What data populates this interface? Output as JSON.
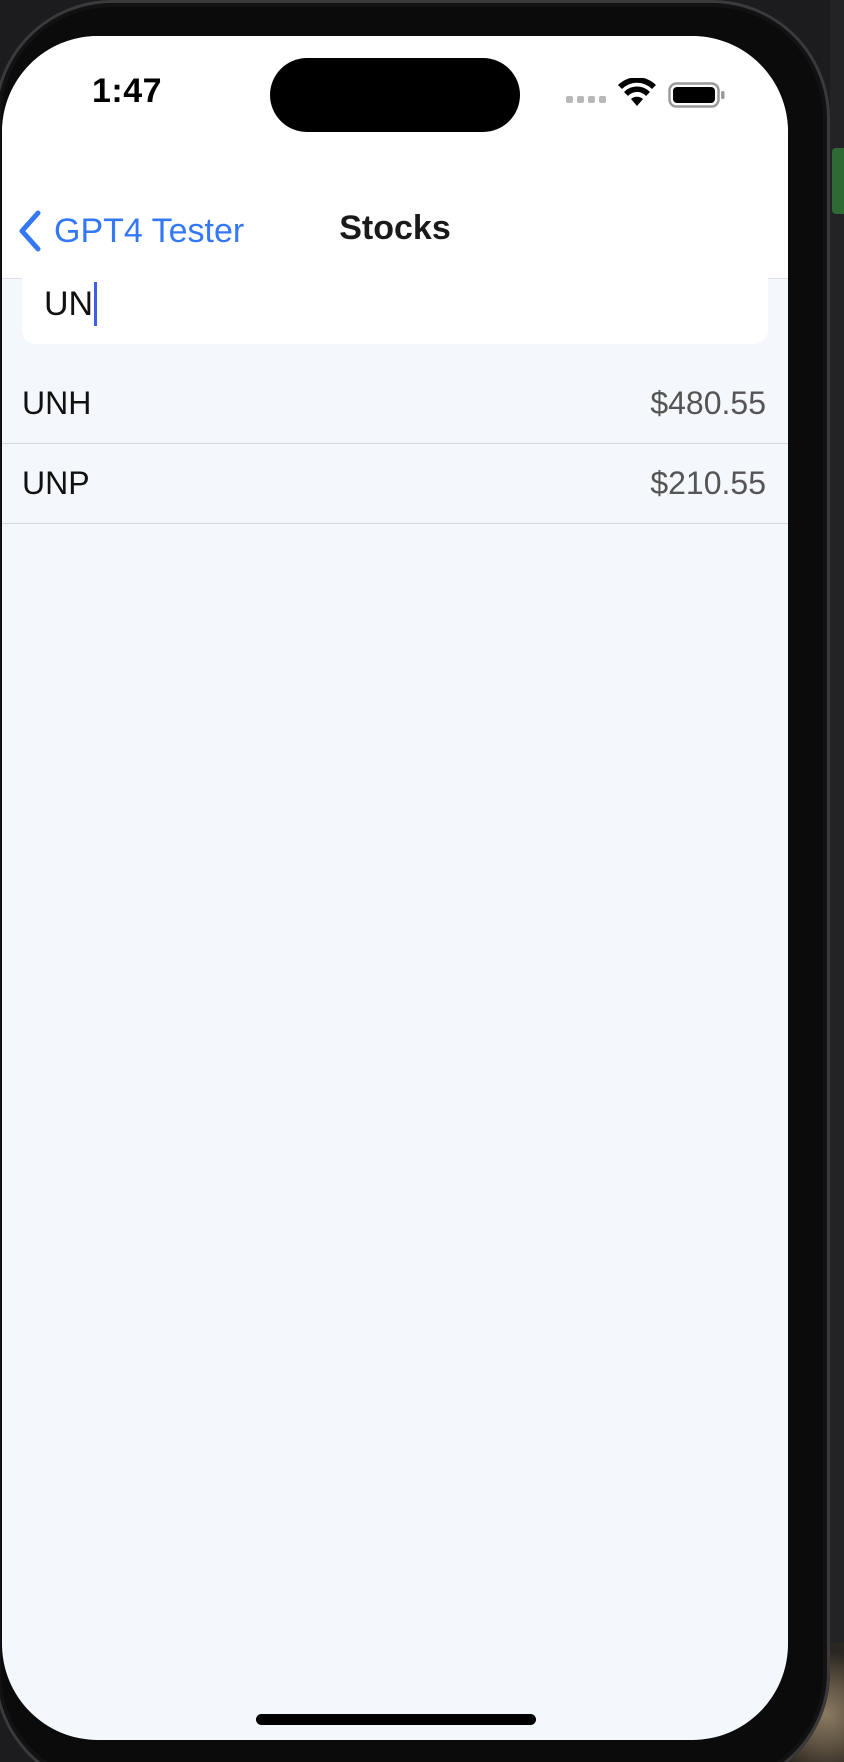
{
  "status_bar": {
    "time": "1:47"
  },
  "nav": {
    "back_label": "GPT4 Tester",
    "title": "Stocks"
  },
  "search": {
    "value": "UN"
  },
  "stocks": [
    {
      "symbol": "UNH",
      "price": "$480.55"
    },
    {
      "symbol": "UNP",
      "price": "$210.55"
    }
  ],
  "colors": {
    "accent": "#3478f6",
    "caret": "#3d5ee6",
    "screen_background": "#f4f8fc"
  },
  "icons": [
    "cellular-signal-icon",
    "wifi-icon",
    "battery-icon",
    "chevron-left-icon"
  ]
}
